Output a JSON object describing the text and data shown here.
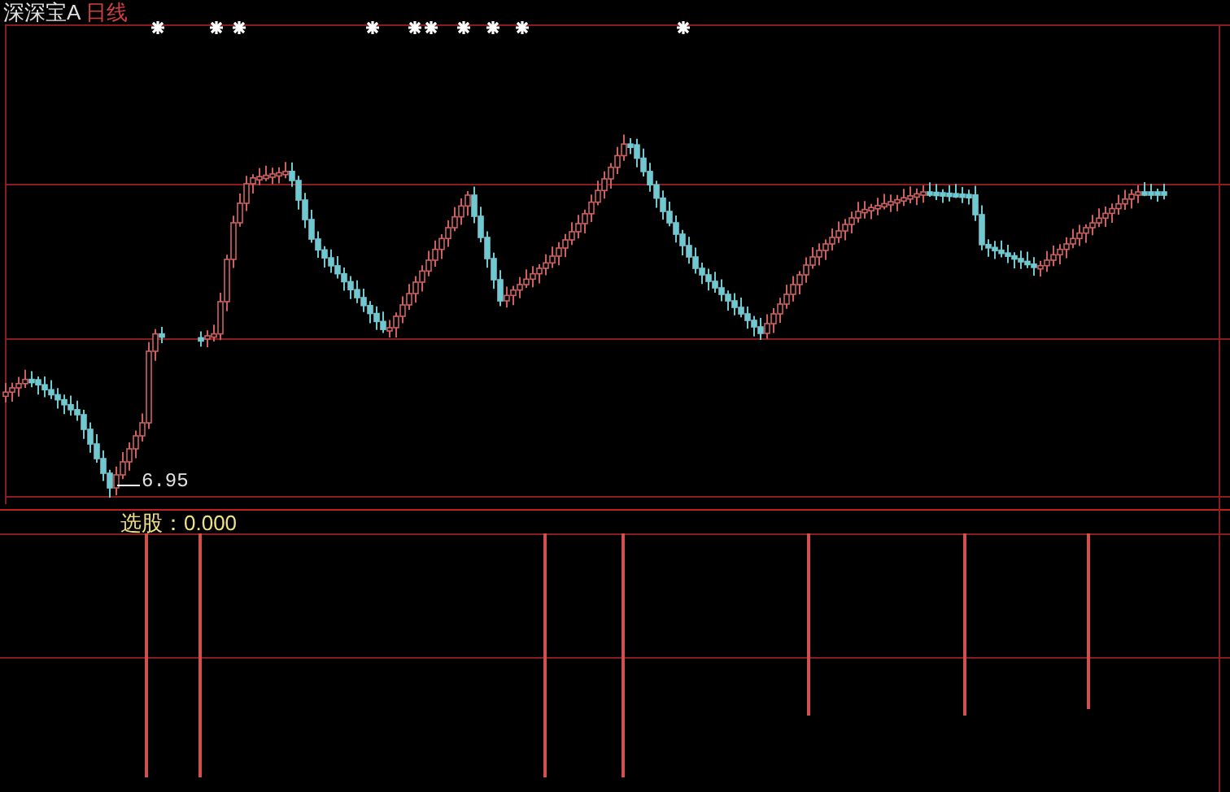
{
  "chart": {
    "stock_name": "深深宝A",
    "period": "日线",
    "low_label": "6.95",
    "indicator": "选股：0.000"
  }
}
